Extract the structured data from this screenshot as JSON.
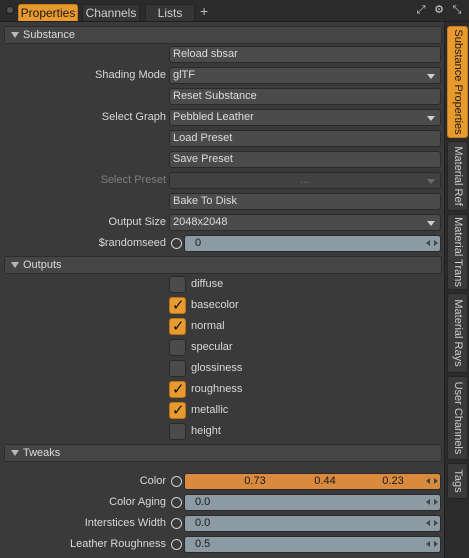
{
  "tabs": [
    {
      "label": "Properties",
      "active": true
    },
    {
      "label": "Channels",
      "active": false
    },
    {
      "label": "Lists",
      "active": false
    }
  ],
  "add_tab_symbol": "+",
  "top_icons": [
    "expand-icon",
    "gear-icon",
    "collapse-icon"
  ],
  "sections": {
    "substance": {
      "title": "Substance"
    },
    "outputs": {
      "title": "Outputs"
    },
    "tweaks": {
      "title": "Tweaks"
    }
  },
  "substance": {
    "reload_label": "Reload sbsar",
    "shading_mode_label": "Shading Mode",
    "shading_mode_value": "glTF",
    "reset_label": "Reset Substance",
    "select_graph_label": "Select Graph",
    "select_graph_value": "Pebbled Leather",
    "load_preset_label": "Load Preset",
    "save_preset_label": "Save Preset",
    "select_preset_label": "Select Preset",
    "select_preset_value": "...",
    "bake_label": "Bake To Disk",
    "output_size_label": "Output Size",
    "output_size_value": "2048x2048",
    "randomseed_label": "$randomseed",
    "randomseed_value": "0"
  },
  "outputs": [
    {
      "label": "diffuse",
      "checked": false
    },
    {
      "label": "basecolor",
      "checked": true
    },
    {
      "label": "normal",
      "checked": true
    },
    {
      "label": "specular",
      "checked": false
    },
    {
      "label": "glossiness",
      "checked": false
    },
    {
      "label": "roughness",
      "checked": true
    },
    {
      "label": "metallic",
      "checked": true
    },
    {
      "label": "height",
      "checked": false
    }
  ],
  "tweaks": {
    "color_label": "Color",
    "color_values": [
      "0.73",
      "0.44",
      "0.23"
    ],
    "color_aging_label": "Color Aging",
    "color_aging_value": "0.0",
    "interstices_label": "Interstices Width",
    "interstices_value": "0.0",
    "leather_roughness_label": "Leather Roughness",
    "leather_roughness_value": "0.5"
  },
  "side_tabs": [
    {
      "label": "Substance Properties",
      "active": true
    },
    {
      "label": "Material Ref",
      "active": false
    },
    {
      "label": "Material Trans",
      "active": false
    },
    {
      "label": "Material Rays",
      "active": false
    },
    {
      "label": "User Channels",
      "active": false
    },
    {
      "label": "Tags",
      "active": false
    }
  ],
  "colors": {
    "accent": "#e99a2e",
    "color_swatch": "#d98a3d",
    "field_blue": "#8c9aa3"
  }
}
